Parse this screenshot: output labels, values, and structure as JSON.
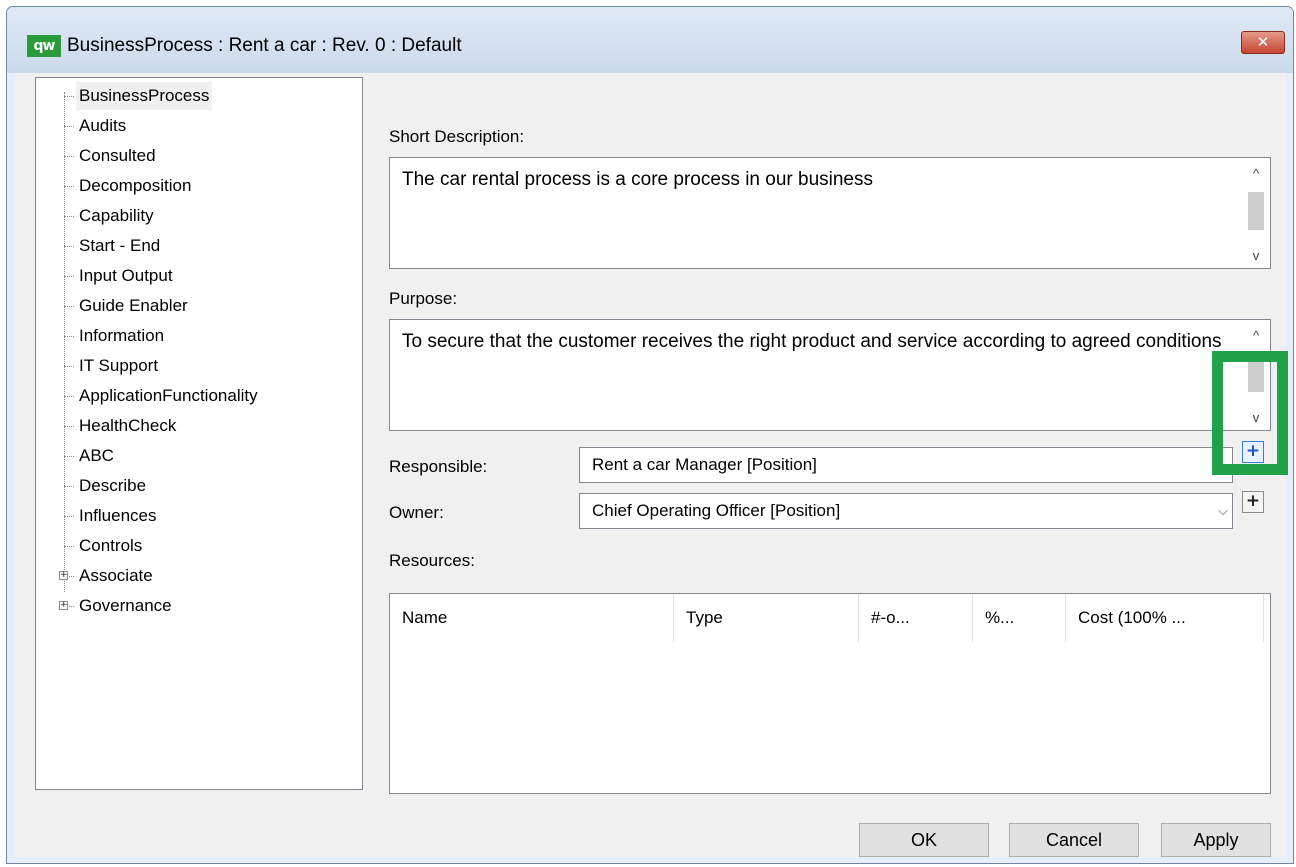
{
  "window": {
    "app_icon": "qw",
    "title": "BusinessProcess : Rent a car : Rev. 0  : Default",
    "close_icon": "✕"
  },
  "tree": {
    "items": [
      {
        "label": "BusinessProcess",
        "selected": true
      },
      {
        "label": "Audits"
      },
      {
        "label": "Consulted"
      },
      {
        "label": "Decomposition"
      },
      {
        "label": "Capability"
      },
      {
        "label": "Start - End"
      },
      {
        "label": "Input Output"
      },
      {
        "label": "Guide Enabler"
      },
      {
        "label": "Information"
      },
      {
        "label": "IT Support"
      },
      {
        "label": "ApplicationFunctionality"
      },
      {
        "label": "HealthCheck"
      },
      {
        "label": "ABC"
      },
      {
        "label": "Describe"
      },
      {
        "label": "Influences"
      },
      {
        "label": "Controls"
      },
      {
        "label": "Associate",
        "expandable": true
      },
      {
        "label": "Governance",
        "expandable": true
      }
    ]
  },
  "form": {
    "short_description_label": "Short Description:",
    "short_description_value": "The car rental process is a core process in our business",
    "purpose_label": "Purpose:",
    "purpose_value": "To secure that the customer receives the right product and service according to agreed conditions",
    "responsible_label": "Responsible:",
    "responsible_value": "Rent a car Manager [Position]",
    "owner_label": "Owner:",
    "owner_value": "Chief Operating Officer [Position]",
    "resources_label": "Resources:",
    "plus_symbol": "+",
    "scroll_up": "^",
    "scroll_down": "v",
    "dropdown_arrow": "⌵"
  },
  "resources_table": {
    "columns": [
      "Name",
      "Type",
      "#-o...",
      "%...",
      "Cost (100% ..."
    ],
    "rows": []
  },
  "buttons": {
    "ok": "OK",
    "cancel": "Cancel",
    "apply": "Apply"
  },
  "colors": {
    "highlight": "#21a24a",
    "app_icon": "#2a9a3a",
    "close_button": "#c5452f"
  }
}
